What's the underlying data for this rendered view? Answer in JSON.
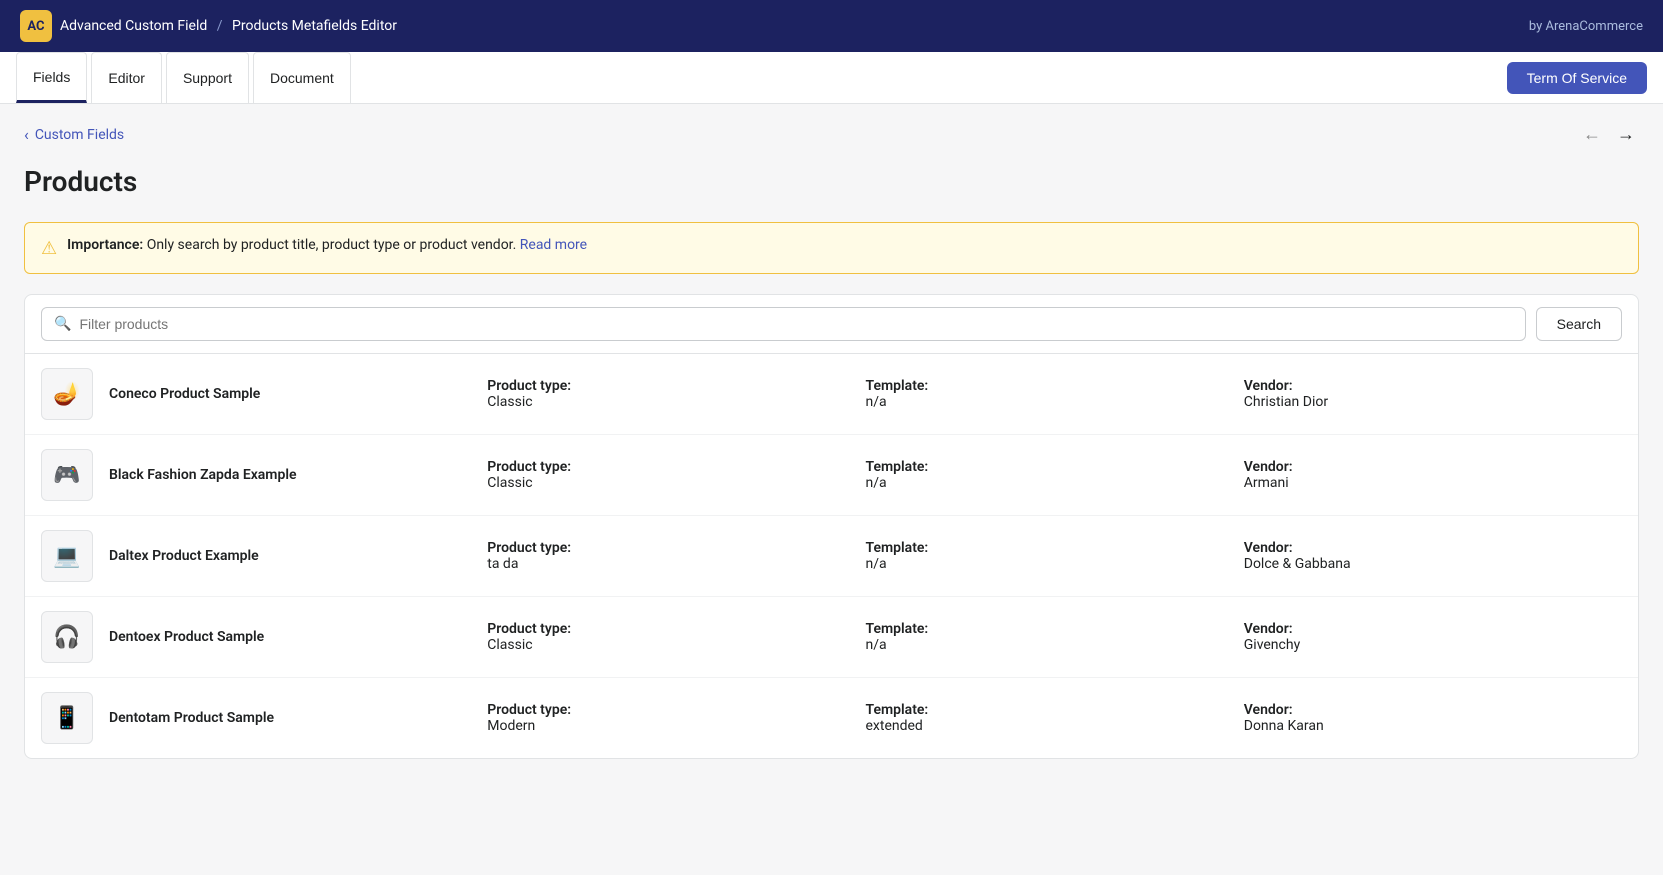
{
  "topBar": {
    "logoText": "AC",
    "appName": "Advanced Custom Field",
    "separator": "/",
    "pageSection": "Products Metafields Editor",
    "byText": "by ArenaCommerce"
  },
  "navTabs": [
    {
      "id": "fields",
      "label": "Fields",
      "active": true
    },
    {
      "id": "editor",
      "label": "Editor",
      "active": false
    },
    {
      "id": "support",
      "label": "Support",
      "active": false
    },
    {
      "id": "document",
      "label": "Document",
      "active": false
    }
  ],
  "termOfServiceBtn": "Term Of Service",
  "breadcrumb": {
    "label": "Custom Fields",
    "backArrow": "‹"
  },
  "navArrows": {
    "prev": "←",
    "next": "→"
  },
  "pageTitle": "Products",
  "alertBanner": {
    "icon": "⚠",
    "boldText": "Importance:",
    "text": " Only search by product title, product type or product vendor.",
    "linkText": "Read more"
  },
  "search": {
    "placeholder": "Filter products",
    "buttonLabel": "Search"
  },
  "products": [
    {
      "id": 1,
      "icon": "🪔",
      "name": "Coneco Product Sample",
      "productType": {
        "label": "Product type:",
        "value": "Classic"
      },
      "template": {
        "label": "Template:",
        "value": "n/a"
      },
      "vendor": {
        "label": "Vendor:",
        "value": "Christian Dior"
      }
    },
    {
      "id": 2,
      "icon": "🎮",
      "name": "Black Fashion Zapda Example",
      "productType": {
        "label": "Product type:",
        "value": "Classic"
      },
      "template": {
        "label": "Template:",
        "value": "n/a"
      },
      "vendor": {
        "label": "Vendor:",
        "value": "Armani"
      }
    },
    {
      "id": 3,
      "icon": "💻",
      "name": "Daltex Product Example",
      "productType": {
        "label": "Product type:",
        "value": "ta da"
      },
      "template": {
        "label": "Template:",
        "value": "n/a"
      },
      "vendor": {
        "label": "Vendor:",
        "value": "Dolce & Gabbana"
      }
    },
    {
      "id": 4,
      "icon": "🎧",
      "name": "Dentoex Product Sample",
      "productType": {
        "label": "Product type:",
        "value": "Classic"
      },
      "template": {
        "label": "Template:",
        "value": "n/a"
      },
      "vendor": {
        "label": "Vendor:",
        "value": "Givenchy"
      }
    },
    {
      "id": 5,
      "icon": "📱",
      "name": "Dentotam Product Sample",
      "productType": {
        "label": "Product type:",
        "value": "Modern"
      },
      "template": {
        "label": "Template:",
        "value": "extended"
      },
      "vendor": {
        "label": "Vendor:",
        "value": "Donna Karan"
      }
    }
  ]
}
